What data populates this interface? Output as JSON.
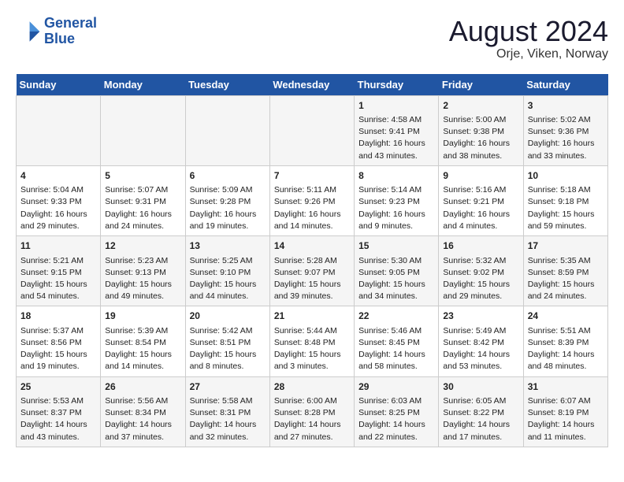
{
  "header": {
    "logo_line1": "General",
    "logo_line2": "Blue",
    "title": "August 2024",
    "subtitle": "Orje, Viken, Norway"
  },
  "calendar": {
    "days_of_week": [
      "Sunday",
      "Monday",
      "Tuesday",
      "Wednesday",
      "Thursday",
      "Friday",
      "Saturday"
    ],
    "weeks": [
      [
        {
          "day": "",
          "info": ""
        },
        {
          "day": "",
          "info": ""
        },
        {
          "day": "",
          "info": ""
        },
        {
          "day": "",
          "info": ""
        },
        {
          "day": "1",
          "info": "Sunrise: 4:58 AM\nSunset: 9:41 PM\nDaylight: 16 hours and 43 minutes."
        },
        {
          "day": "2",
          "info": "Sunrise: 5:00 AM\nSunset: 9:38 PM\nDaylight: 16 hours and 38 minutes."
        },
        {
          "day": "3",
          "info": "Sunrise: 5:02 AM\nSunset: 9:36 PM\nDaylight: 16 hours and 33 minutes."
        }
      ],
      [
        {
          "day": "4",
          "info": "Sunrise: 5:04 AM\nSunset: 9:33 PM\nDaylight: 16 hours and 29 minutes."
        },
        {
          "day": "5",
          "info": "Sunrise: 5:07 AM\nSunset: 9:31 PM\nDaylight: 16 hours and 24 minutes."
        },
        {
          "day": "6",
          "info": "Sunrise: 5:09 AM\nSunset: 9:28 PM\nDaylight: 16 hours and 19 minutes."
        },
        {
          "day": "7",
          "info": "Sunrise: 5:11 AM\nSunset: 9:26 PM\nDaylight: 16 hours and 14 minutes."
        },
        {
          "day": "8",
          "info": "Sunrise: 5:14 AM\nSunset: 9:23 PM\nDaylight: 16 hours and 9 minutes."
        },
        {
          "day": "9",
          "info": "Sunrise: 5:16 AM\nSunset: 9:21 PM\nDaylight: 16 hours and 4 minutes."
        },
        {
          "day": "10",
          "info": "Sunrise: 5:18 AM\nSunset: 9:18 PM\nDaylight: 15 hours and 59 minutes."
        }
      ],
      [
        {
          "day": "11",
          "info": "Sunrise: 5:21 AM\nSunset: 9:15 PM\nDaylight: 15 hours and 54 minutes."
        },
        {
          "day": "12",
          "info": "Sunrise: 5:23 AM\nSunset: 9:13 PM\nDaylight: 15 hours and 49 minutes."
        },
        {
          "day": "13",
          "info": "Sunrise: 5:25 AM\nSunset: 9:10 PM\nDaylight: 15 hours and 44 minutes."
        },
        {
          "day": "14",
          "info": "Sunrise: 5:28 AM\nSunset: 9:07 PM\nDaylight: 15 hours and 39 minutes."
        },
        {
          "day": "15",
          "info": "Sunrise: 5:30 AM\nSunset: 9:05 PM\nDaylight: 15 hours and 34 minutes."
        },
        {
          "day": "16",
          "info": "Sunrise: 5:32 AM\nSunset: 9:02 PM\nDaylight: 15 hours and 29 minutes."
        },
        {
          "day": "17",
          "info": "Sunrise: 5:35 AM\nSunset: 8:59 PM\nDaylight: 15 hours and 24 minutes."
        }
      ],
      [
        {
          "day": "18",
          "info": "Sunrise: 5:37 AM\nSunset: 8:56 PM\nDaylight: 15 hours and 19 minutes."
        },
        {
          "day": "19",
          "info": "Sunrise: 5:39 AM\nSunset: 8:54 PM\nDaylight: 15 hours and 14 minutes."
        },
        {
          "day": "20",
          "info": "Sunrise: 5:42 AM\nSunset: 8:51 PM\nDaylight: 15 hours and 8 minutes."
        },
        {
          "day": "21",
          "info": "Sunrise: 5:44 AM\nSunset: 8:48 PM\nDaylight: 15 hours and 3 minutes."
        },
        {
          "day": "22",
          "info": "Sunrise: 5:46 AM\nSunset: 8:45 PM\nDaylight: 14 hours and 58 minutes."
        },
        {
          "day": "23",
          "info": "Sunrise: 5:49 AM\nSunset: 8:42 PM\nDaylight: 14 hours and 53 minutes."
        },
        {
          "day": "24",
          "info": "Sunrise: 5:51 AM\nSunset: 8:39 PM\nDaylight: 14 hours and 48 minutes."
        }
      ],
      [
        {
          "day": "25",
          "info": "Sunrise: 5:53 AM\nSunset: 8:37 PM\nDaylight: 14 hours and 43 minutes."
        },
        {
          "day": "26",
          "info": "Sunrise: 5:56 AM\nSunset: 8:34 PM\nDaylight: 14 hours and 37 minutes."
        },
        {
          "day": "27",
          "info": "Sunrise: 5:58 AM\nSunset: 8:31 PM\nDaylight: 14 hours and 32 minutes."
        },
        {
          "day": "28",
          "info": "Sunrise: 6:00 AM\nSunset: 8:28 PM\nDaylight: 14 hours and 27 minutes."
        },
        {
          "day": "29",
          "info": "Sunrise: 6:03 AM\nSunset: 8:25 PM\nDaylight: 14 hours and 22 minutes."
        },
        {
          "day": "30",
          "info": "Sunrise: 6:05 AM\nSunset: 8:22 PM\nDaylight: 14 hours and 17 minutes."
        },
        {
          "day": "31",
          "info": "Sunrise: 6:07 AM\nSunset: 8:19 PM\nDaylight: 14 hours and 11 minutes."
        }
      ]
    ]
  }
}
